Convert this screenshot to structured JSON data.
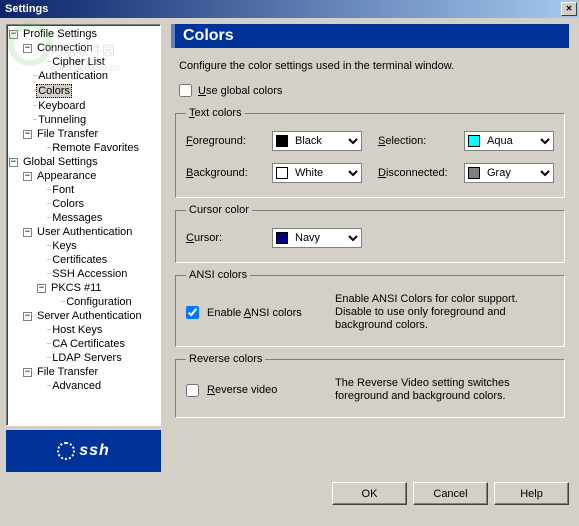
{
  "window": {
    "title": "Settings"
  },
  "watermark": {
    "text": "河东软件园",
    "url": "www.pc0359.cn"
  },
  "tree": {
    "profile": "Profile Settings",
    "connection": "Connection",
    "cipher": "Cipher List",
    "auth": "Authentication",
    "colors": "Colors",
    "keyboard": "Keyboard",
    "tunneling": "Tunneling",
    "filetransfer": "File Transfer",
    "remotefav": "Remote Favorites",
    "global": "Global Settings",
    "appearance": "Appearance",
    "font": "Font",
    "colors2": "Colors",
    "messages": "Messages",
    "userauth": "User Authentication",
    "keys": "Keys",
    "certs": "Certificates",
    "sshacc": "SSH Accession",
    "pkcs": "PKCS #11",
    "config": "Configuration",
    "serverauth": "Server Authentication",
    "hostkeys": "Host Keys",
    "cacerts": "CA Certificates",
    "ldap": "LDAP Servers",
    "filetransfer2": "File Transfer",
    "advanced": "Advanced"
  },
  "panel": {
    "title": "Colors",
    "desc": "Configure the color settings used in the terminal window.",
    "useglobal": "Use global colors",
    "group_text": "Text colors",
    "foreground": "Foreground:",
    "background": "Background:",
    "selection": "Selection:",
    "disconnected": "Disconnected:",
    "group_cursor": "Cursor color",
    "cursor": "Cursor:",
    "group_ansi": "ANSI colors",
    "enable_ansi": "Enable ANSI colors",
    "ansi_hint": "Enable ANSI Colors for color support. Disable to use only foreground and background colors.",
    "group_reverse": "Reverse colors",
    "reverse": "Reverse video",
    "reverse_hint": "The Reverse Video setting switches foreground and background colors."
  },
  "colors": {
    "fg": {
      "name": "Black",
      "hex": "#000000"
    },
    "bg": {
      "name": "White",
      "hex": "#ffffff"
    },
    "sel": {
      "name": "Aqua",
      "hex": "#00ffff"
    },
    "disc": {
      "name": "Gray",
      "hex": "#808080"
    },
    "cur": {
      "name": "Navy",
      "hex": "#000080"
    }
  },
  "buttons": {
    "ok": "OK",
    "cancel": "Cancel",
    "help": "Help"
  },
  "logo": "ssh"
}
